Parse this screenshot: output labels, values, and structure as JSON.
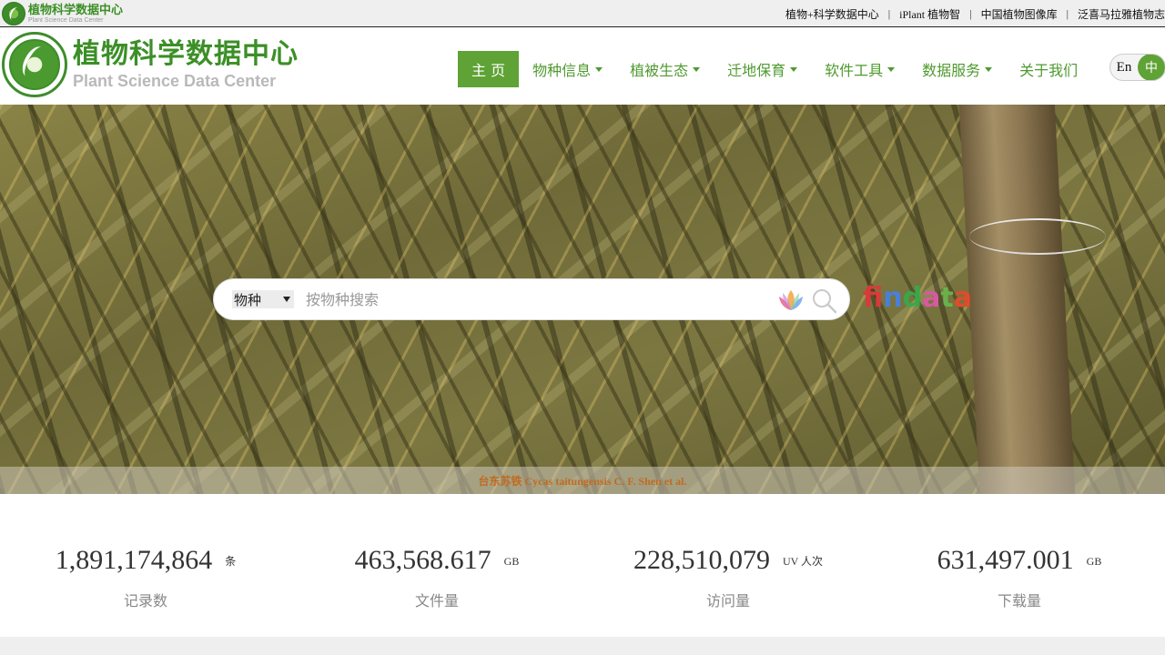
{
  "topbar": {
    "logo_cn": "植物科学数据中心",
    "logo_en": "Plant Science Data Center",
    "links": [
      "植物+科学数据中心",
      "iPlant 植物智",
      "中国植物图像库",
      "泛喜马拉雅植物志"
    ],
    "separator": "|"
  },
  "header": {
    "logo_cn": "植物科学数据中心",
    "logo_en": "Plant Science Data Center",
    "nav": [
      {
        "label": "主 页",
        "dropdown": false,
        "active": true
      },
      {
        "label": "物种信息",
        "dropdown": true,
        "active": false
      },
      {
        "label": "植被生态",
        "dropdown": true,
        "active": false
      },
      {
        "label": "迁地保育",
        "dropdown": true,
        "active": false
      },
      {
        "label": "软件工具",
        "dropdown": true,
        "active": false
      },
      {
        "label": "数据服务",
        "dropdown": true,
        "active": false
      },
      {
        "label": "关于我们",
        "dropdown": false,
        "active": false
      }
    ],
    "lang_en": "En",
    "lang_zh": "中"
  },
  "search": {
    "select_value": "物种",
    "placeholder": "按物种搜索",
    "findata_brand": "findata"
  },
  "banner": {
    "caption": "台东苏铁 Cycas taitungensis C. F. Shen et al."
  },
  "stats": [
    {
      "value": "1,891,174,864",
      "unit": "条",
      "label": "记录数"
    },
    {
      "value": "463,568.617",
      "unit": "GB",
      "label": "文件量"
    },
    {
      "value": "228,510,079",
      "unit": "UV 人次",
      "label": "访问量"
    },
    {
      "value": "631,497.001",
      "unit": "GB",
      "label": "下载量"
    }
  ],
  "colors": {
    "brand_green": "#5fa235",
    "nav_text": "#4f9a2f",
    "caption_text": "#c16a21"
  }
}
